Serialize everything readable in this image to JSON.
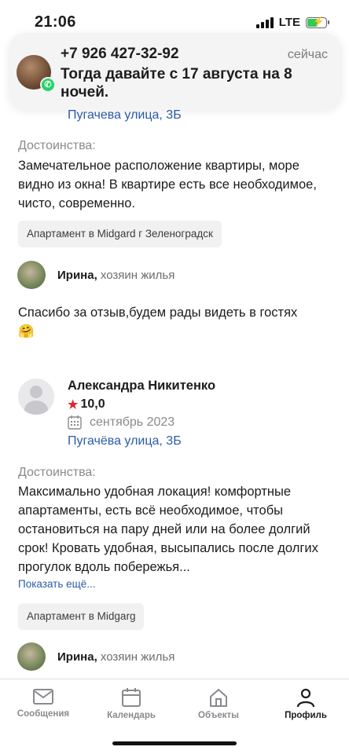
{
  "status": {
    "time": "21:06",
    "network": "LTE"
  },
  "notification": {
    "title": "+7 926 427-32-92",
    "time": "сейчас",
    "body": "Тогда давайте с 17 августа на 8 ночей."
  },
  "review1": {
    "address": "Пугачева улица, 3Б",
    "pros_label": "Достоинства:",
    "pros_text": "Замечательное расположение квартиры, море видно из окна! В квартире есть все необходимое, чисто, современно.",
    "tag": "Апартамент в Midgard г Зеленоградск",
    "reply_name": "Ирина,",
    "reply_role": "хозяин жилья",
    "reply_text": "Спасибо за отзыв,будем рады видеть в гостях",
    "reply_emoji": "🤗"
  },
  "review2": {
    "author": "Александра Никитенко",
    "rating": "10,0",
    "date": "сентябрь 2023",
    "address": "Пугачёва улица, 3Б",
    "pros_label": "Достоинства:",
    "pros_text": "Максимально удобная локация! комфортные апартаменты, есть всё необходимое, чтобы остановиться на пару дней или на более долгий срок! Кровать удобная, высыпались после долгих прогулок вдоль побережья...",
    "show_more": "Показать ещё...",
    "tag": "Апартамент в Midgarg",
    "reply_name": "Ирина,",
    "reply_role": "хозяин жилья"
  },
  "tabbar": {
    "messages": "Сообщения",
    "calendar": "Календарь",
    "objects": "Объекты",
    "profile": "Профиль"
  },
  "colors": {
    "link": "#2a5ca8",
    "star": "#e0262e",
    "whatsapp": "#25d366"
  }
}
